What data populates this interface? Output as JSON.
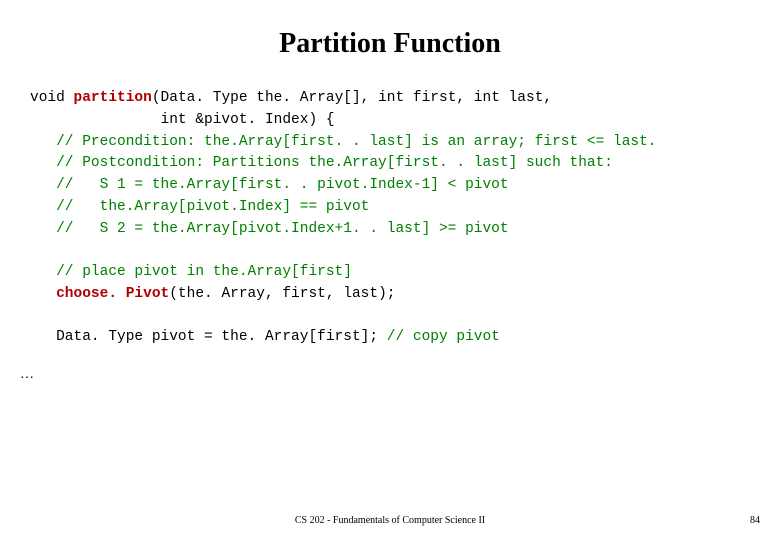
{
  "title": "Partition Function",
  "code": {
    "kw_void": "void ",
    "fn_name": "partition",
    "sig_part1": "(Data. Type the. Array[], int first, int last,",
    "sig_part2": "               int &pivot. Index) {",
    "c1": "   // Precondition: the.Array[first. . last] is an array; first <= last.",
    "c2": "   // Postcondition: Partitions the.Array[first. . last] such that:",
    "c3": "   //   S 1 = the.Array[first. . pivot.Index-1] < pivot",
    "c4": "   //   the.Array[pivot.Index] == pivot",
    "c5": "   //   S 2 = the.Array[pivot.Index+1. . last] >= pivot",
    "c_place": "   // place pivot in the.Array[first]",
    "call_name": "   choose. Pivot",
    "call_args": "(the. Array, first, last);",
    "copy_stmt": "   Data. Type pivot = the. Array[first]; ",
    "copy_comment": "// copy pivot"
  },
  "ellipsis": "…",
  "footer": "CS 202 - Fundamentals of Computer Science II",
  "page": "84"
}
